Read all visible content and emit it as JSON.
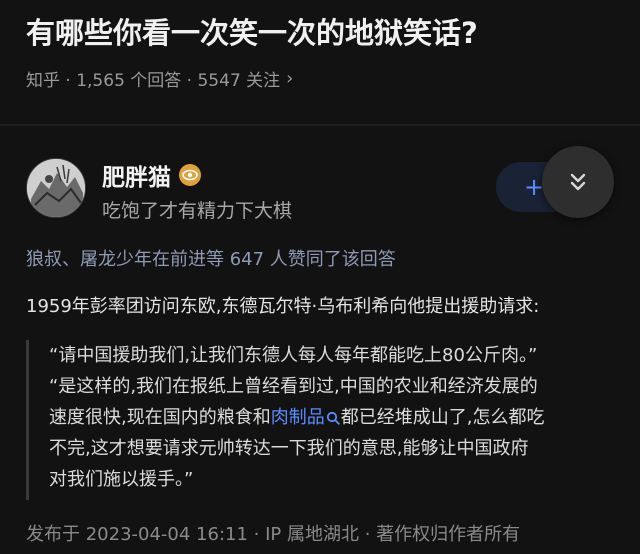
{
  "question": {
    "title": "有哪些你看一次笑一次的地狱笑话?",
    "meta": "知乎 · 1,565 个回答 · 5547 关注"
  },
  "author": {
    "name": "肥胖猫",
    "bio": "吃饱了才有精力下大棋",
    "follow_icon": "plus-icon"
  },
  "collapse_icon": "double-chevron-down-icon",
  "upvote_line": "狼叔、屠龙少年在前进等 647 人赞同了该回答",
  "answer": {
    "intro": "1959年彭率团访问东欧,东德瓦尔特·乌布利希向他提出援助请求:",
    "quote_line1": "“请中国援助我们,让我们东德人每人每年都能吃上80公斤肉。”",
    "quote_line2": "“是这样的,我们在报纸上曾经看到过,中国的农业和经济发展的",
    "quote_line3_before": "速度很快,现在国内的粮食和",
    "quote_line3_link": "肉制品",
    "quote_line3_after": "都已经堆成山了,怎么都吃",
    "quote_line4": "不完,这才想要请求元帅转达一下我们的意思,能够让中国政府",
    "quote_line5": "对我们施以援手。”"
  },
  "footer": "发布于 2023-04-04 16:11 · IP 属地湖北 · 著作权归作者所有",
  "colors": {
    "background": "#121212",
    "link": "#5b8cff",
    "upvote_text": "#8d9bb7"
  }
}
